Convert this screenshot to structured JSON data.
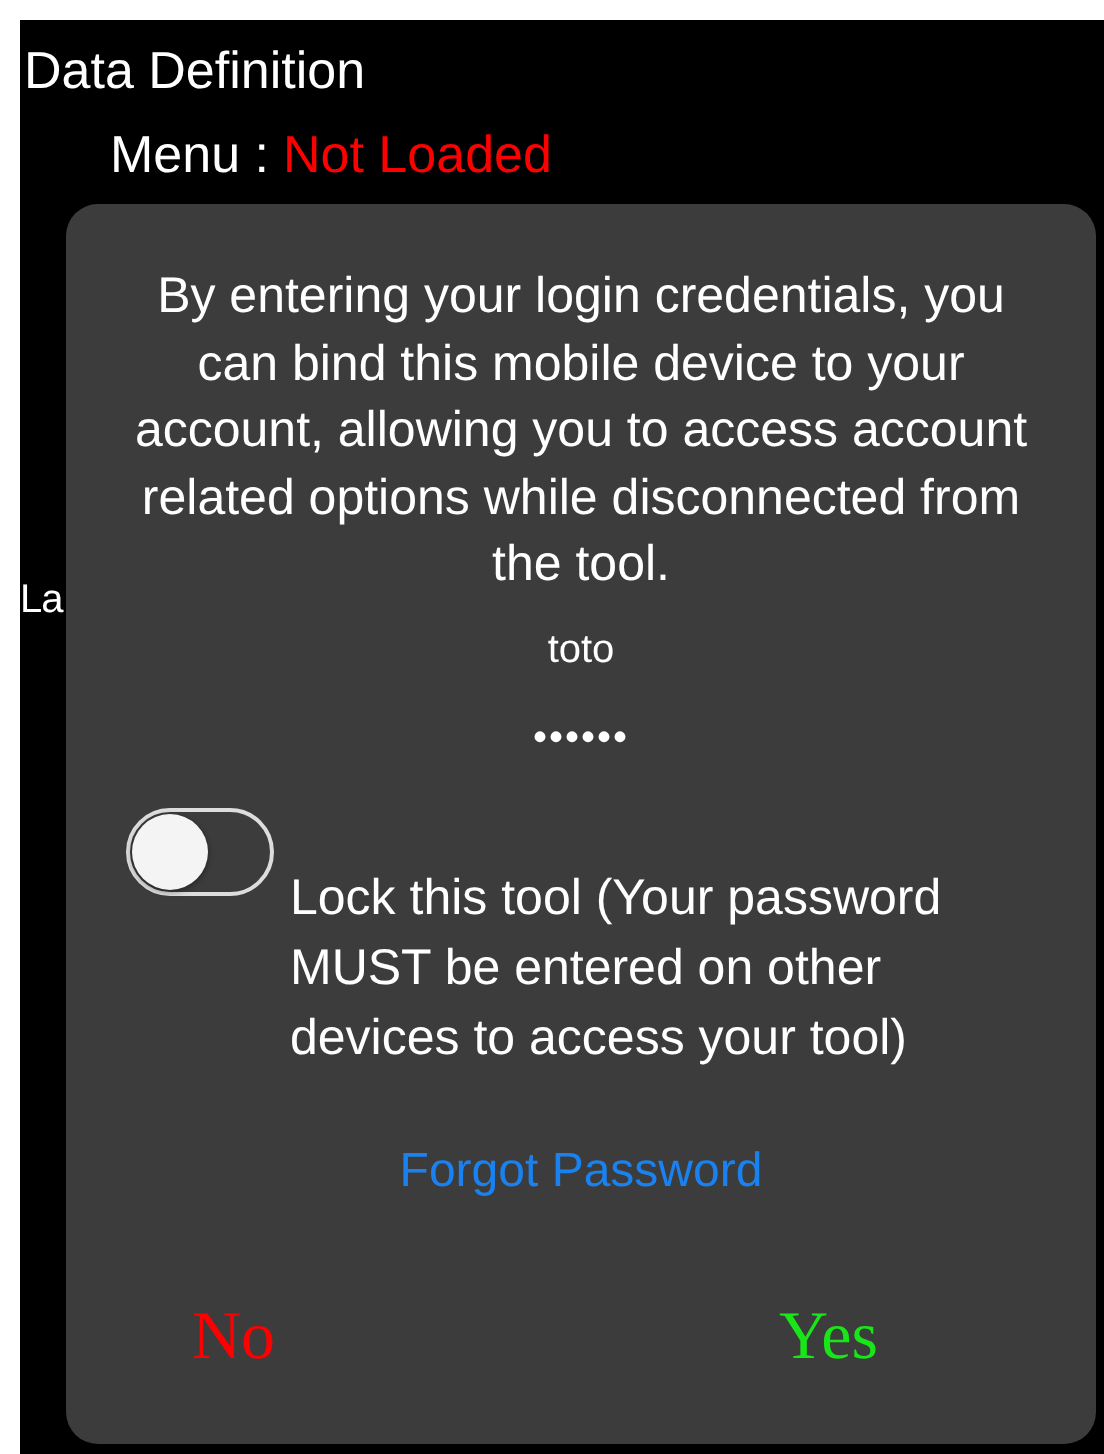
{
  "background": {
    "section_title": "Data Definition",
    "rows": [
      {
        "label": "Menu :",
        "value": "Not Loaded",
        "kind": "status"
      }
    ],
    "cut_label": "La"
  },
  "dialog": {
    "message": "By entering your login credentials, you can bind this mobile device to your account, allowing you to access account related options while disconnected from the tool.",
    "username": {
      "value": "toto"
    },
    "password": {
      "value": "••••••"
    },
    "lock_toggle": {
      "on": false,
      "label": "Lock this tool (Your password MUST be entered on other devices to access your tool)"
    },
    "forgot_link": "Forgot Password",
    "buttons": [
      {
        "label": "No",
        "kind": "cancel"
      },
      {
        "label": "Yes",
        "kind": "confirm"
      }
    ]
  }
}
